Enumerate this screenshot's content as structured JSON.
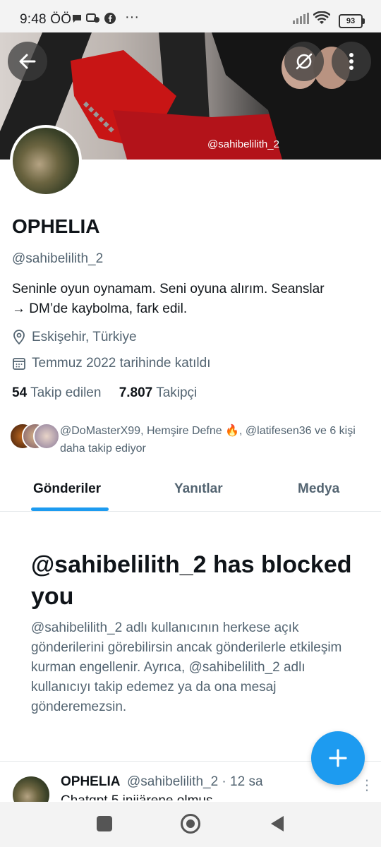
{
  "status_bar": {
    "time": "9:48 ÖÖ",
    "overflow": "···",
    "battery": "93"
  },
  "banner": {
    "watermark": "@sahibelilith_2"
  },
  "profile": {
    "display_name": "OPHELIA",
    "handle": "@sahibelilith_2",
    "bio_line1": "Seninle oyun oynamam. Seni oyuna alırım. Seanslar",
    "bio_line2": "→ DM’de kaybolma, fark edil.",
    "location": "Eskişehir, Türkiye",
    "joined": "Temmuz 2022 tarihinde katıldı",
    "following_count": "54",
    "following_label": "Takip edilen",
    "followers_count": "7.807",
    "followers_label": "Takipçi",
    "followers_you_know": "@DoMasterX99, Hemşire Defne 🔥, @latifesen36 ve 6 kişi daha takip ediyor"
  },
  "tabs": [
    {
      "label": "Gönderiler",
      "active": true
    },
    {
      "label": "Yanıtlar",
      "active": false
    },
    {
      "label": "Medya",
      "active": false
    }
  ],
  "blocked": {
    "title": "@sahibelilith_2 has blocked you",
    "body": "@sahibelilith_2 adlı kullanıcının herkese açık gönderilerini görebilirsin ancak gönderilerle etkileşim kurman engellenir. Ayrıca, @sahibelilith_2 adlı kullanıcıyı takip edemez ya da ona mesaj gönderemezsin."
  },
  "tweet": {
    "name": "OPHELIA",
    "handle_time": "@sahibelilith_2 · 12 sa",
    "text": "Chatgpt 5 inijärene olmus",
    "more": "⋮"
  },
  "fab": {
    "icon": "+"
  },
  "colors": {
    "accent": "#1d9bf0",
    "muted": "#536471",
    "text": "#0f1419"
  }
}
